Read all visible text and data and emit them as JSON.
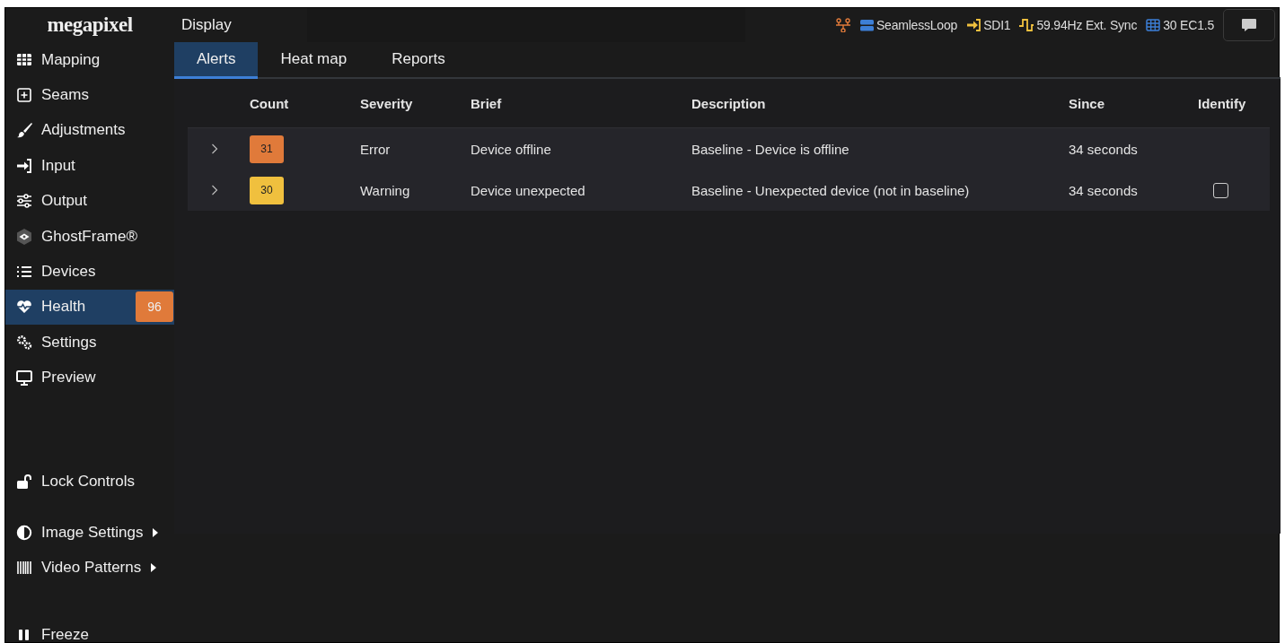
{
  "logo": "megapixel",
  "window": {
    "title": "Display"
  },
  "status": [
    {
      "kind": "network"
    },
    {
      "kind": "server",
      "text": "SeamlessLoop"
    },
    {
      "kind": "input",
      "text": "SDI1"
    },
    {
      "kind": "sync",
      "text": "59.94Hz Ext. Sync"
    },
    {
      "kind": "grid",
      "text": "30 EC1.5"
    }
  ],
  "sidebar": {
    "items": [
      {
        "label": "Mapping",
        "selected": false
      },
      {
        "label": "Seams",
        "selected": false
      },
      {
        "label": "Adjustments",
        "selected": false
      },
      {
        "label": "Input",
        "selected": false
      },
      {
        "label": "Output",
        "selected": false
      },
      {
        "label": "GhostFrame®",
        "selected": false
      },
      {
        "label": "Devices",
        "selected": false
      },
      {
        "label": "Health",
        "selected": true,
        "badge": "96"
      },
      {
        "label": "Settings",
        "selected": false
      },
      {
        "label": "Preview",
        "selected": false
      }
    ],
    "lower_sections": [
      [
        {
          "label": "Lock Controls",
          "submenu": false
        }
      ],
      [
        {
          "label": "Image Settings",
          "submenu": true
        },
        {
          "label": "Video Patterns",
          "submenu": true
        }
      ],
      [
        {
          "label": "Freeze",
          "submenu": false
        }
      ]
    ]
  },
  "tabs": [
    {
      "label": "Alerts",
      "selected": true
    },
    {
      "label": "Heat map",
      "selected": false
    },
    {
      "label": "Reports",
      "selected": false
    }
  ],
  "table": {
    "columns": [
      "Count",
      "Severity",
      "Brief",
      "Description",
      "Since",
      "Identify"
    ],
    "rows": [
      {
        "count": "31",
        "color": "#e07a3a",
        "severity": "Error",
        "brief": "Device offline",
        "description": "Baseline - Device is offline",
        "since": "34 seconds"
      },
      {
        "count": "30",
        "color": "#f0c03e",
        "severity": "Warning",
        "brief": "Device unexpected",
        "description": "Baseline - Unexpected device (not in baseline)",
        "since": "34 seconds",
        "identify": {
          "checked": false
        }
      }
    ]
  }
}
